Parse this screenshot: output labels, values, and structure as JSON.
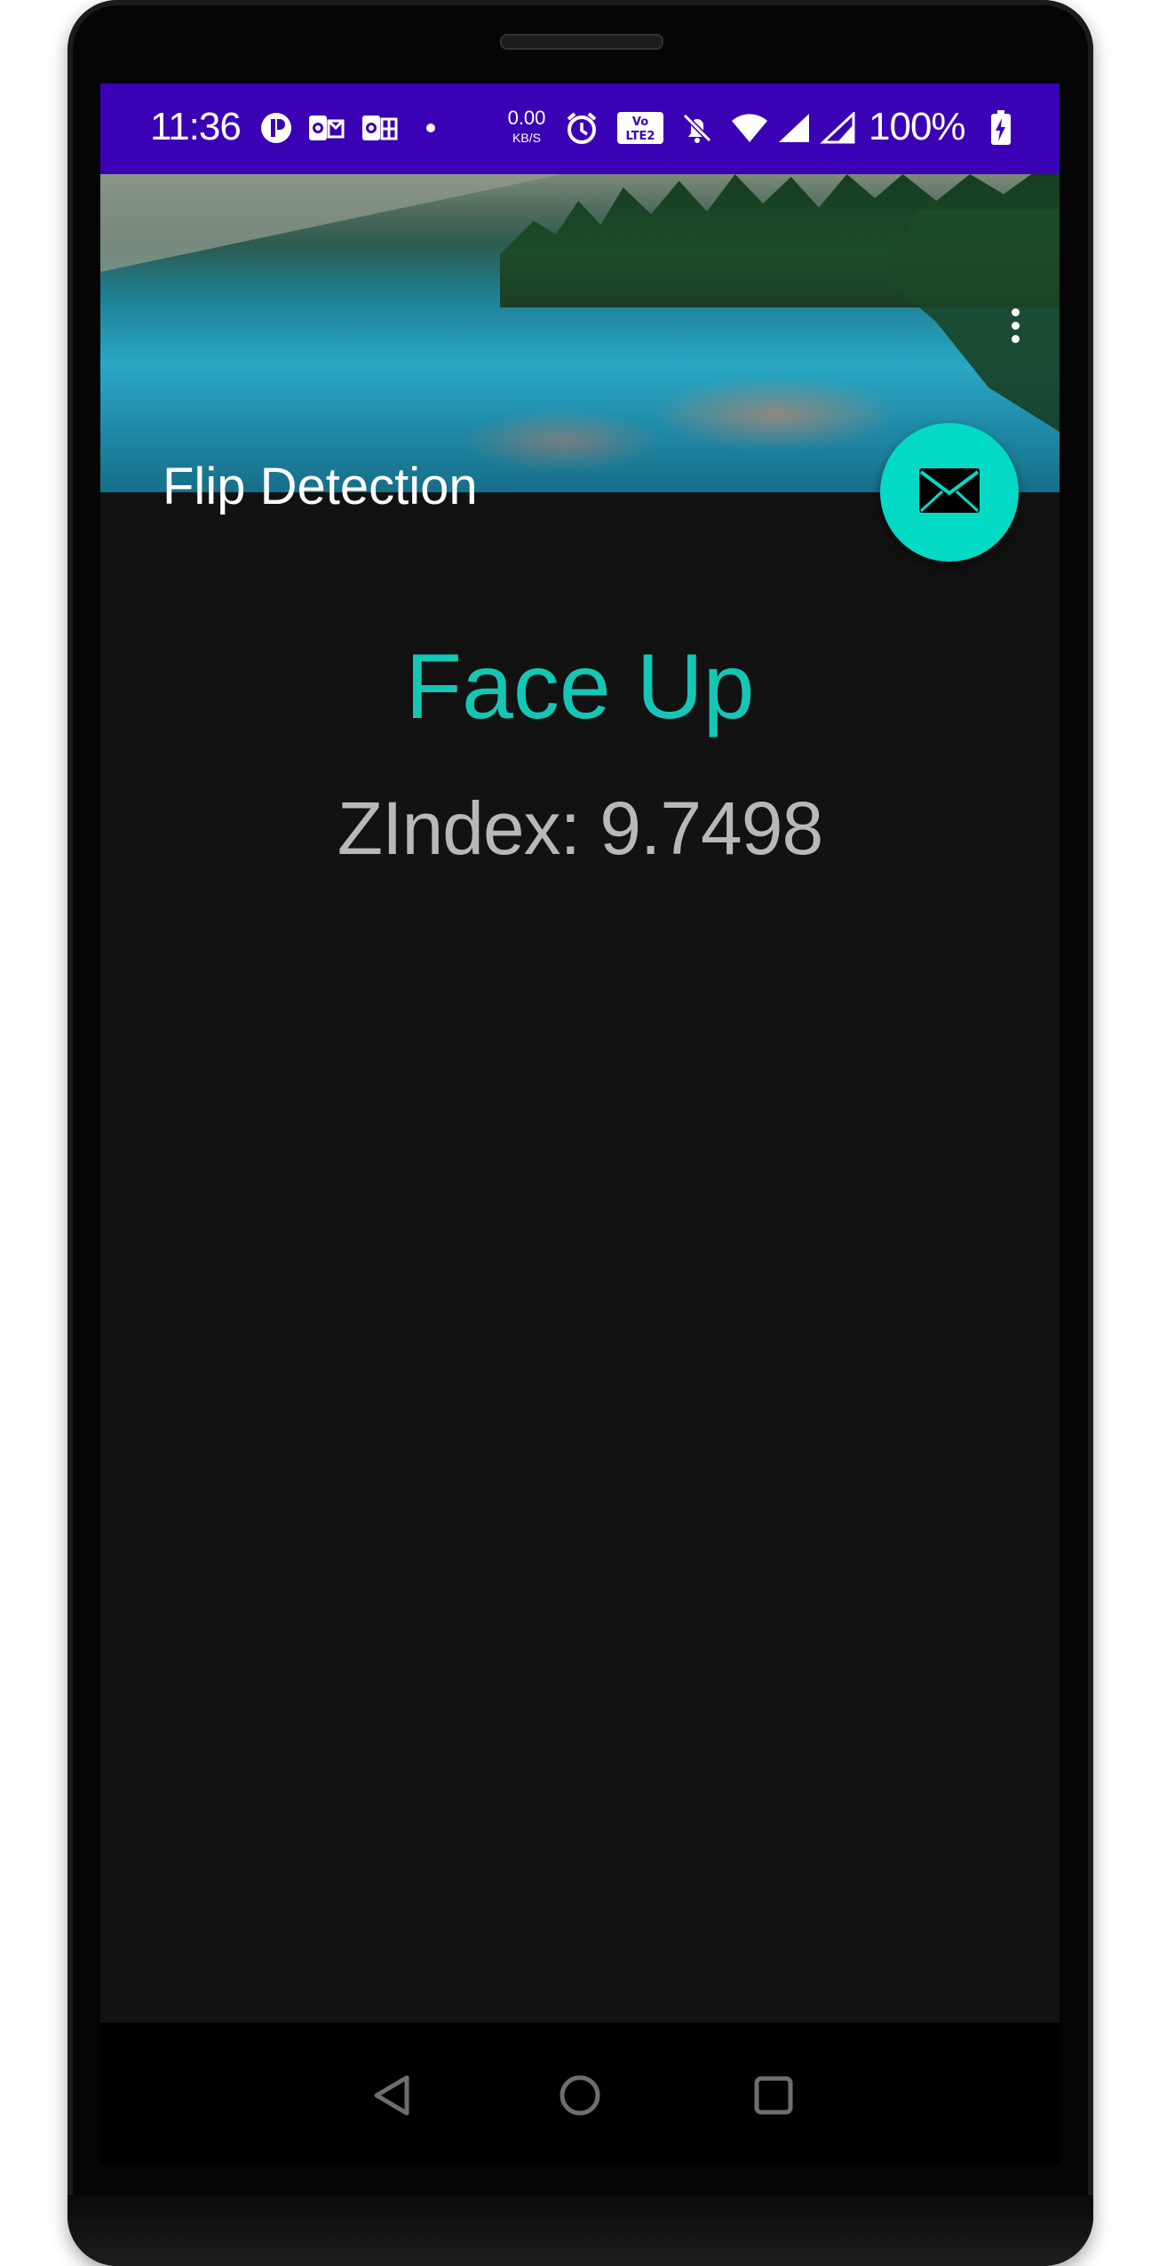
{
  "status_bar": {
    "time": "11:36",
    "netspeed_value": "0.00",
    "netspeed_unit": "KB/S",
    "battery_percent": "100%",
    "icons": [
      "app-notification-icon",
      "outlook-icon",
      "office-icon",
      "dot-icon",
      "alarm-icon",
      "volte-icon",
      "mute-bell-icon",
      "wifi-icon",
      "signal-icon",
      "signal-icon",
      "battery-charging-icon"
    ],
    "background": "#3a02b4"
  },
  "app_bar": {
    "title": "Flip Detection",
    "menu_icon": "more-vert-icon"
  },
  "fab": {
    "icon": "mail-icon",
    "color": "#03dac5"
  },
  "main": {
    "face_status": "Face Up",
    "zindex_label": "ZIndex: 9.7498",
    "accent": "#16c6b5"
  },
  "nav": {
    "back_icon": "back-triangle-icon",
    "home_icon": "home-circle-icon",
    "recents_icon": "recents-square-icon"
  }
}
